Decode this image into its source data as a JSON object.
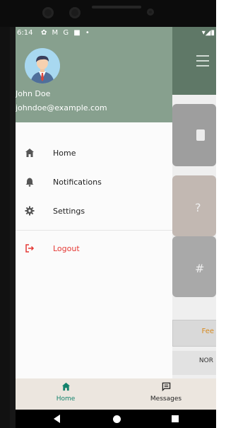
{
  "status_bar": {
    "time": "6:14",
    "icons": "✿ M G ■ •",
    "right_icons": "▾◢▮"
  },
  "drawer": {
    "user_name": "John Doe",
    "user_email": "johndoe@example.com",
    "items": [
      {
        "label": "Home",
        "icon": "home-icon"
      },
      {
        "label": "Notifications",
        "icon": "bell-icon"
      },
      {
        "label": "Settings",
        "icon": "gear-icon"
      }
    ],
    "logout": {
      "label": "Logout",
      "icon": "logout-icon"
    }
  },
  "background": {
    "card_icons": [
      "?",
      "#"
    ],
    "strip_text": "Fee",
    "strip2_text": "NOR"
  },
  "bottom_nav": {
    "items": [
      {
        "label": "Home",
        "icon": "home-icon",
        "active": true
      },
      {
        "label": "Messages",
        "icon": "message-icon",
        "active": false
      }
    ]
  },
  "colors": {
    "drawer_header": "#87a08e",
    "accent": "#13826c",
    "logout": "#e53935"
  }
}
